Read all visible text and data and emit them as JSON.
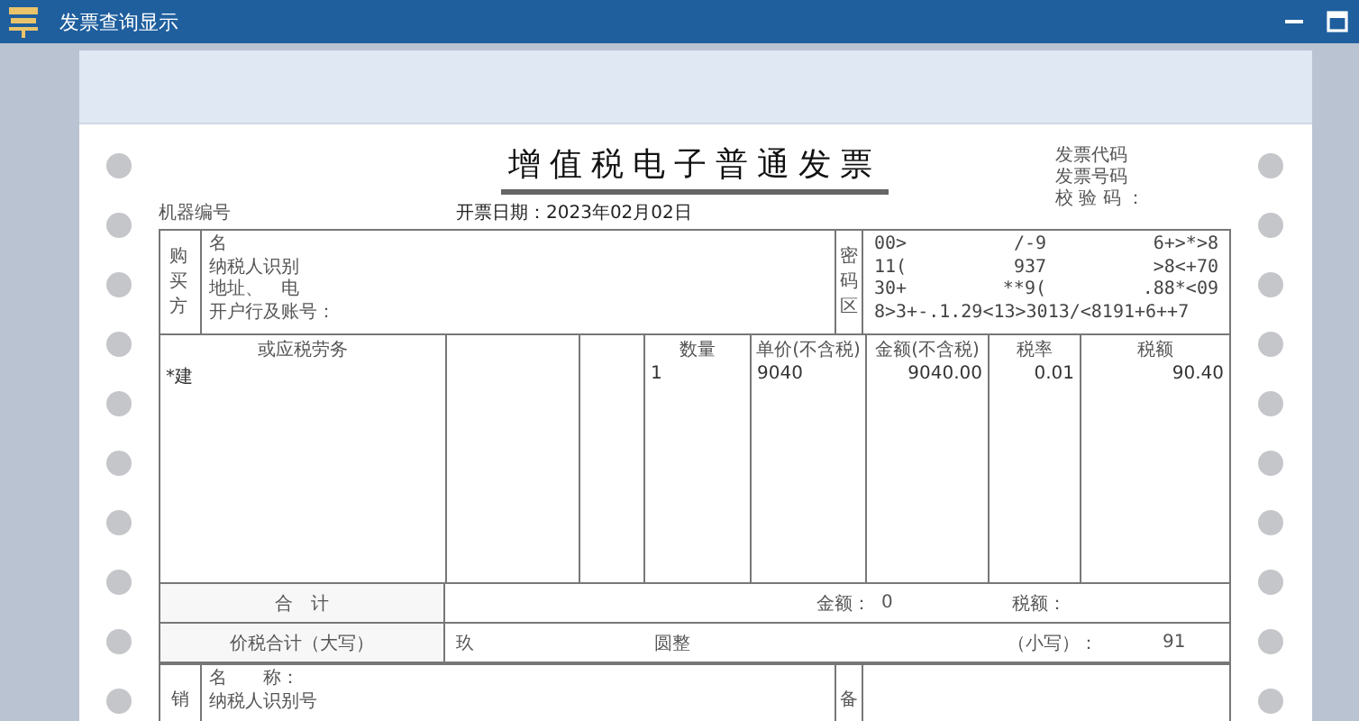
{
  "window": {
    "title": "发票查询显示"
  },
  "invoice": {
    "title": "增值税电子普通发票",
    "code_label": "发票代码",
    "number_label": "发票号码",
    "check_label": "校 验 码 ：",
    "machine_label": "机器编号",
    "issue_date": "开票日期：2023年02月02日"
  },
  "buyer": {
    "side_label": "购买方",
    "fields": [
      "名",
      "纳税人识别",
      "地址、　电",
      "开户行及账号："
    ],
    "cipher_label": "密码区",
    "cipher_lines": [
      [
        "00>",
        "/-9",
        "6+>*>8"
      ],
      [
        "11(",
        "937",
        ">8<+70"
      ],
      [
        "30+",
        "**9(",
        ".88*<09"
      ],
      [
        "8>3+-.1.29<13>3013/<8191+6++7"
      ]
    ]
  },
  "items": {
    "columns": [
      {
        "header": "或应税劳务",
        "value": "*建"
      },
      {},
      {},
      {
        "header": "数量",
        "value": "1"
      },
      {
        "header": "单价(不含税)",
        "value": "9040"
      },
      {
        "header": "金额(不含税)",
        "value": "9040.00"
      },
      {
        "header": "税率",
        "value": "0.01"
      },
      {
        "header": "税额",
        "value": "90.40"
      }
    ]
  },
  "totals": {
    "label": "合　计",
    "amount_label": "金额：",
    "amount_value": "0",
    "tax_label": "税额："
  },
  "grand_total": {
    "label": "价税合计（大写）",
    "words": [
      "玖",
      "圆整"
    ],
    "small_label": "（小写）：",
    "small_value": "91"
  },
  "seller": {
    "side_label": "销",
    "fields": [
      "名　　称：",
      "纳税人识别号"
    ],
    "remark_label": "备"
  }
}
